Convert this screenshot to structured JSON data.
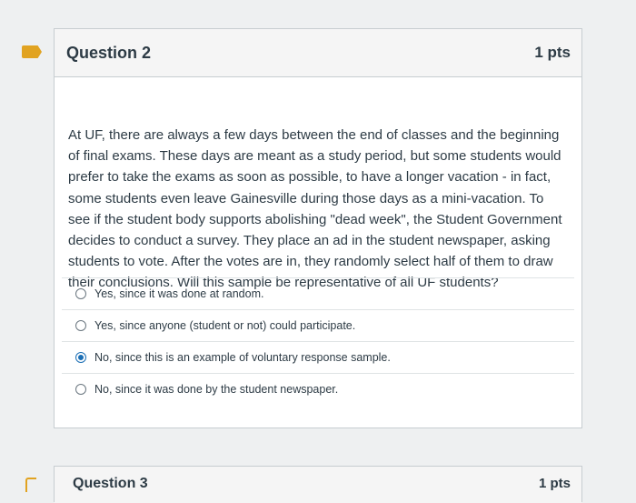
{
  "question": {
    "title": "Question 2",
    "points": "1 pts",
    "text": "At UF, there are always a few days between the end of classes and the beginning of final exams. These days are meant as a study period, but some students would prefer to take the exams as soon as possible, to have a longer vacation - in fact, some students even leave Gainesville during those days as a mini-vacation. To see if the student body supports abolishing \"dead week\", the Student Government decides to conduct a survey. They place an ad in the student newspaper, asking students to vote. After the votes are in, they randomly select half of them to draw their conclusions. Will this sample be representative of all UF students?",
    "answers": [
      {
        "label": "Yes, since it was done at random.",
        "selected": false
      },
      {
        "label": "Yes, since anyone (student or not) could participate.",
        "selected": false
      },
      {
        "label": "No, since this is an example of voluntary response sample.",
        "selected": true
      },
      {
        "label": "No, since it was done by the student newspaper.",
        "selected": false
      }
    ]
  },
  "next_question": {
    "title": "Question 3",
    "points": "1 pts"
  },
  "colors": {
    "marker": "#e1a321",
    "radio_selected": "#1c6fb5",
    "text": "#2d3b45"
  }
}
